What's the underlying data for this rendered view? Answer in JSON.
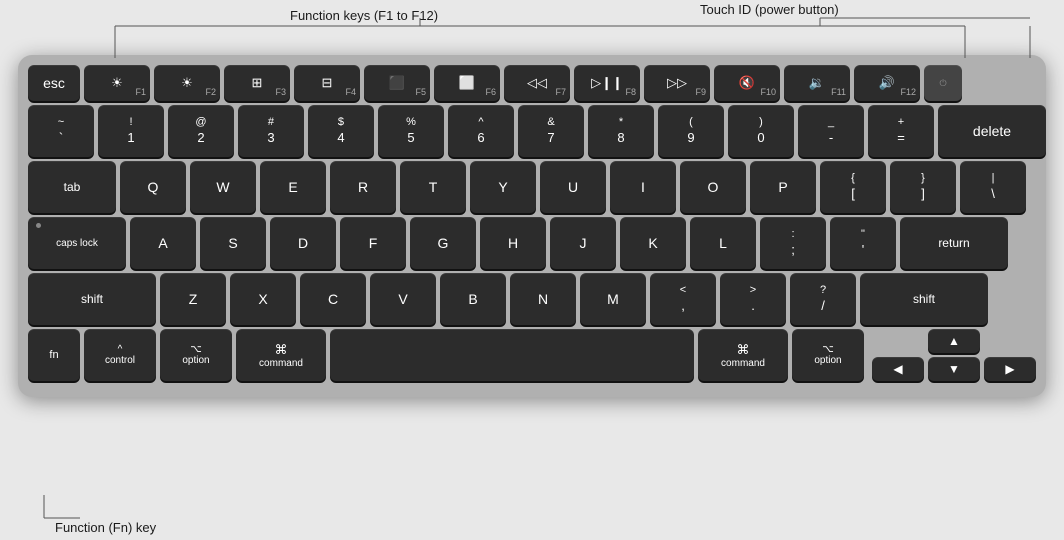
{
  "annotations": {
    "function_keys_label": "Function keys (F1 to F12)",
    "touch_id_label": "Touch ID (power button)",
    "fn_key_label": "Function (Fn) key"
  },
  "keyboard": {
    "rows": [
      {
        "id": "fn-row",
        "keys": [
          "esc",
          "F1",
          "F2",
          "F3",
          "F4",
          "F5",
          "F6",
          "F7",
          "F8",
          "F9",
          "F10",
          "F11",
          "F12",
          "TouchID"
        ]
      }
    ]
  }
}
